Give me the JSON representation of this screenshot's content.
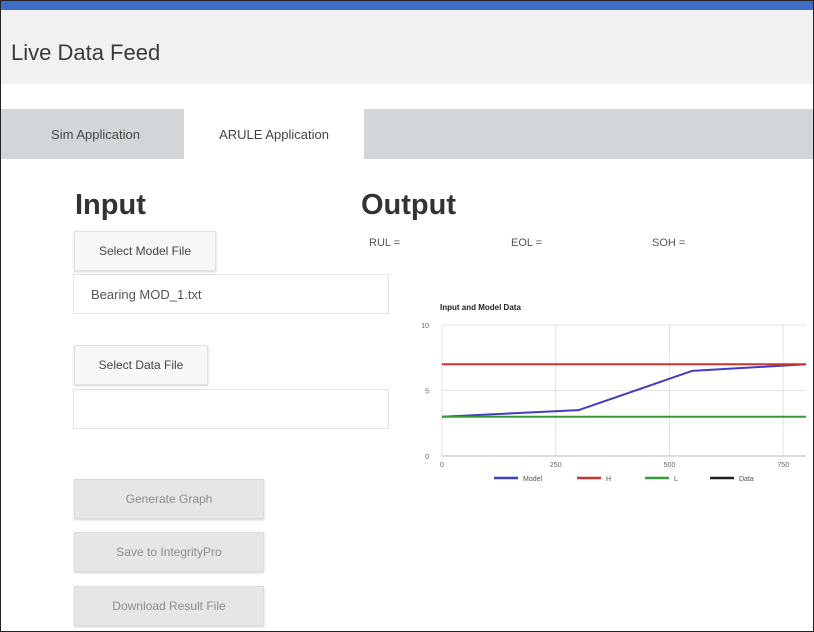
{
  "app": {
    "title": "Live Data Feed"
  },
  "tabs": [
    {
      "label": "Sim Application",
      "active": false
    },
    {
      "label": "ARULE Application",
      "active": true
    }
  ],
  "input": {
    "heading": "Input",
    "select_model_label": "Select Model File",
    "model_file_value": "Bearing MOD_1.txt",
    "select_data_label": "Select Data File",
    "data_file_value": "",
    "generate_label": "Generate Graph",
    "save_label": "Save to IntegrityPro",
    "download_label": "Download Result File"
  },
  "output": {
    "heading": "Output",
    "rul_label": "RUL =",
    "eol_label": "EOL =",
    "soh_label": "SOH ="
  },
  "colors": {
    "topbar": "#3f6dc6",
    "model": "#3f3fbf",
    "H": "#cc3333",
    "L": "#3a9a3a",
    "Data": "#222222"
  },
  "chart_data": {
    "type": "line",
    "title": "Input and Model Data",
    "xlim": [
      0,
      800
    ],
    "ylim": [
      0,
      10
    ],
    "x_ticks": [
      "0",
      "250",
      "500",
      "750"
    ],
    "y_ticks": [
      "0",
      "5",
      "10"
    ],
    "grid": true,
    "legend_position": "bottom",
    "series": [
      {
        "name": "Model",
        "x": [
          0,
          300,
          550,
          800
        ],
        "y": [
          3,
          3.5,
          6.5,
          7
        ]
      },
      {
        "name": "H",
        "x": [
          0,
          800
        ],
        "y": [
          7,
          7
        ]
      },
      {
        "name": "L",
        "x": [
          0,
          800
        ],
        "y": [
          3,
          3
        ]
      },
      {
        "name": "Data",
        "x": [],
        "y": []
      }
    ]
  }
}
